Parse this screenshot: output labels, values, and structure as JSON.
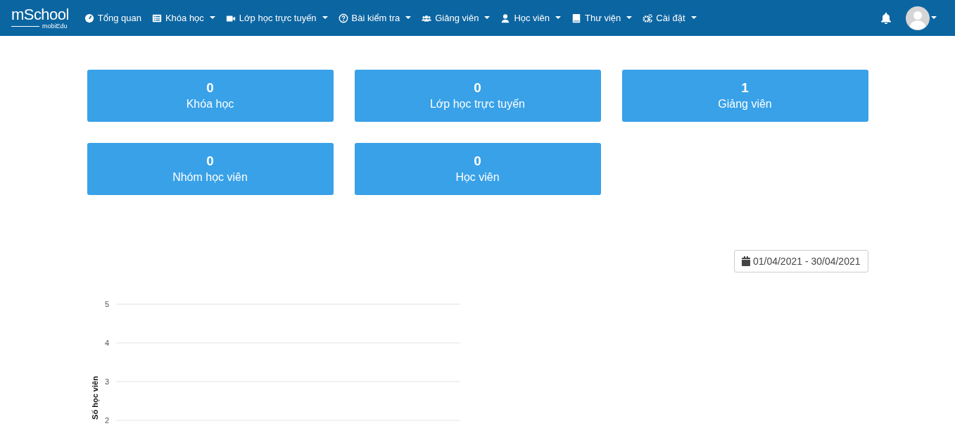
{
  "logo": {
    "text": "mSchool",
    "subtext": "mobiEdu"
  },
  "nav": [
    {
      "label": "Tổng quan",
      "dropdown": false
    },
    {
      "label": "Khóa học",
      "dropdown": true
    },
    {
      "label": "Lớp học trực tuyến",
      "dropdown": true
    },
    {
      "label": "Bài kiểm tra",
      "dropdown": true
    },
    {
      "label": "Giảng viên",
      "dropdown": true
    },
    {
      "label": "Học viên",
      "dropdown": true
    },
    {
      "label": "Thư viện",
      "dropdown": true
    },
    {
      "label": "Cài đặt",
      "dropdown": true
    }
  ],
  "stats": [
    {
      "value": "0",
      "label": "Khóa học"
    },
    {
      "value": "0",
      "label": "Lớp học trực tuyến"
    },
    {
      "value": "1",
      "label": "Giảng viên"
    },
    {
      "value": "0",
      "label": "Nhóm học viên"
    },
    {
      "value": "0",
      "label": "Học viên"
    }
  ],
  "date_range": "01/04/2021 - 30/04/2021",
  "chart": {
    "y_axis_title": "Số học viên",
    "y_tick_labels": [
      "5",
      "4",
      "3",
      "2"
    ]
  }
}
